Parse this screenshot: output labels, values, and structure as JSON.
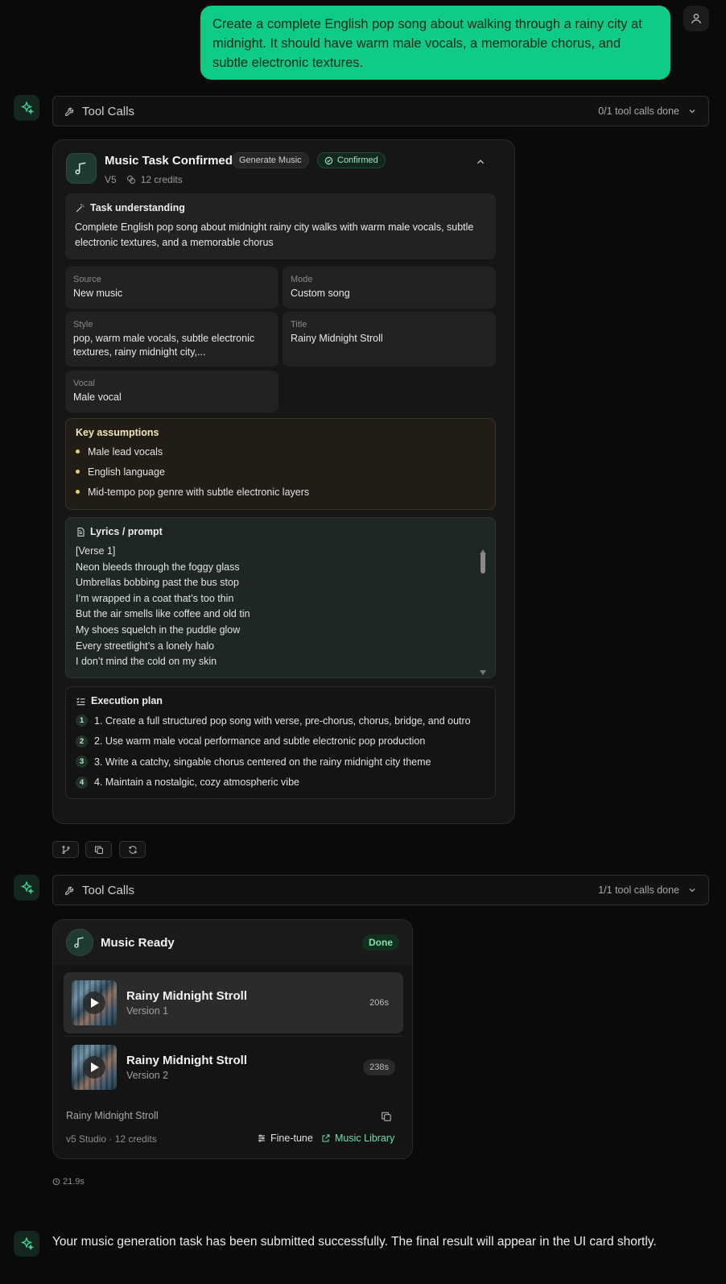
{
  "user_message": "Create a complete English pop song about walking through a rainy city at midnight. It should have warm male vocals, a memorable chorus, and subtle electronic textures.",
  "toolcalls1": {
    "label": "Tool Calls",
    "count": "0/1 tool calls done"
  },
  "task_card": {
    "title": "Music Task Confirmed",
    "chip_generate": "Generate Music",
    "chip_confirmed": "Confirmed",
    "model": "V5",
    "credits": "12 credits",
    "understanding_title": "Task understanding",
    "understanding_text": "Complete English pop song about midnight rainy city walks with warm male vocals, subtle electronic textures, and a memorable chorus",
    "fields": {
      "source_label": "Source",
      "source_value": "New music",
      "mode_label": "Mode",
      "mode_value": "Custom song",
      "style_label": "Style",
      "style_value": "pop, warm male vocals, subtle electronic textures, rainy midnight city,...",
      "title_label": "Title",
      "title_value": "Rainy Midnight Stroll",
      "vocal_label": "Vocal",
      "vocal_value": "Male vocal"
    },
    "assumptions_title": "Key assumptions",
    "assumptions": [
      "Male lead vocals",
      "English language",
      "Mid-tempo pop genre with subtle electronic layers"
    ],
    "lyrics_title": "Lyrics / prompt",
    "lyrics": [
      "[Verse 1]",
      "Neon bleeds through the foggy glass",
      "Umbrellas bobbing past the bus stop",
      "I’m wrapped in a coat that’s too thin",
      "But the air smells like coffee and old tin",
      "My shoes squelch in the puddle glow",
      "Every streetlight’s a lonely halo",
      "I don’t mind the cold on my skin"
    ],
    "plan_title": "Execution plan",
    "plan": [
      {
        "n": "1",
        "text": "1. Create a full structured pop song with verse, pre-chorus, chorus, bridge, and outro"
      },
      {
        "n": "2",
        "text": "2. Use warm male vocal performance and subtle electronic pop production"
      },
      {
        "n": "3",
        "text": "3. Write a catchy, singable chorus centered on the rainy midnight city theme"
      },
      {
        "n": "4",
        "text": "4. Maintain a nostalgic, cozy atmospheric vibe"
      }
    ]
  },
  "toolcalls2": {
    "label": "Tool Calls",
    "count": "1/1 tool calls done"
  },
  "music_card": {
    "title": "Music Ready",
    "status": "Done",
    "tracks": [
      {
        "title": "Rainy Midnight Stroll",
        "version": "Version 1",
        "duration": "206s"
      },
      {
        "title": "Rainy Midnight Stroll",
        "version": "Version 2",
        "duration": "238s"
      }
    ],
    "song_name": "Rainy Midnight Stroll",
    "meta": "v5 Studio · 12 credits",
    "finetune": "Fine-tune",
    "library": "Music Library"
  },
  "elapsed": "21.9s",
  "assistant_message": "Your music generation task has been submitted successfully. The final result will appear in the UI card shortly.",
  "colors": {
    "accent": "#0ecb85",
    "background": "#0a0a0a"
  }
}
